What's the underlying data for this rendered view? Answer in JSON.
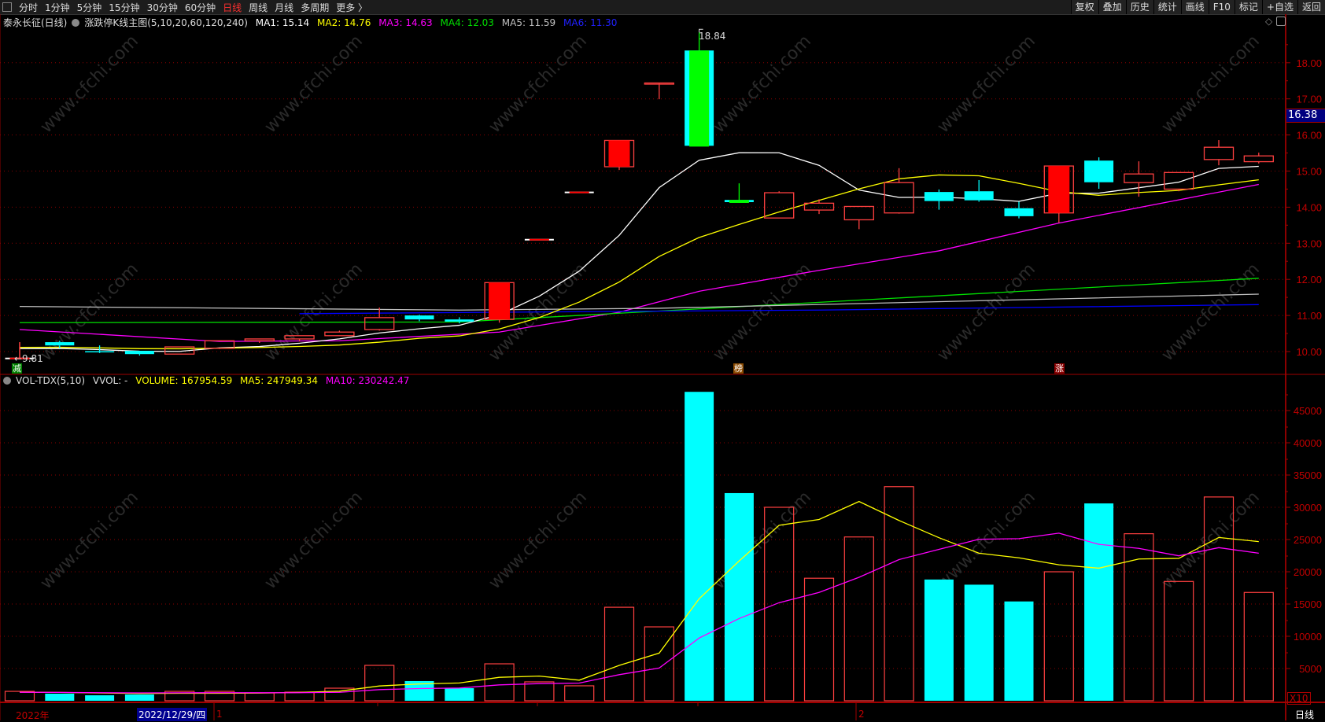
{
  "toolbar": {
    "periods": [
      "分时",
      "1分钟",
      "5分钟",
      "15分钟",
      "30分钟",
      "60分钟",
      "日线",
      "周线",
      "月线",
      "多周期",
      "更多 〉"
    ],
    "active_period": "日线",
    "actions": [
      "复权",
      "叠加",
      "历史",
      "统计",
      "画线",
      "F10",
      "标记",
      "+自选",
      "返回"
    ]
  },
  "info": {
    "stock": "泰永长征(日线)",
    "indicator": "涨跌停K线主图(5,10,20,60,120,240)",
    "ma": [
      {
        "label": "MA1: 15.14",
        "color": "#ffffff"
      },
      {
        "label": "MA2: 14.76",
        "color": "#ffff00"
      },
      {
        "label": "MA3: 14.63",
        "color": "#ff00ff"
      },
      {
        "label": "MA4: 12.03",
        "color": "#00e000"
      },
      {
        "label": "MA5: 11.59",
        "color": "#c0c0c0"
      },
      {
        "label": "MA6: 11.30",
        "color": "#0000ff"
      }
    ]
  },
  "vol_info": {
    "name": "VOL-TDX(5,10)",
    "vvol": "VVOL: -",
    "volume": "VOLUME: 167954.59",
    "ma5": "MA5: 247949.34",
    "ma10": "MA10: 230242.47"
  },
  "labels": {
    "high": "18.84",
    "low": "←9.81",
    "cursor_price": "16.38",
    "vol_unit": "X10",
    "period_tag": "日线",
    "watermark": "www.cfchi.com"
  },
  "markers": [
    {
      "bar": 0,
      "text": "减",
      "bg": "#008000"
    },
    {
      "bar": 18,
      "text": "榜",
      "bg": "#8b4a00"
    },
    {
      "bar": 26,
      "text": "涨",
      "bg": "#8b0000"
    }
  ],
  "date_axis": {
    "year": "2022年",
    "cursor_date": "2022/12/29/四",
    "month_labels": [
      {
        "bar": 5,
        "text": "1"
      },
      {
        "bar": 21,
        "text": "2"
      }
    ]
  },
  "chart_data": [
    {
      "type": "candlestick",
      "title": "泰永长征(日线)",
      "ylim": [
        9.6,
        18.9
      ],
      "yticks": [
        "10.00",
        "11.00",
        "12.00",
        "13.00",
        "14.00",
        "15.00",
        "16.00",
        "17.00",
        "18.00"
      ],
      "colors": {
        "up": "#ff4040",
        "down": "#00ffff",
        "limit_fill": "#ff0000",
        "green_core": "#00ff00"
      },
      "ohlc": [
        [
          9.81,
          10.26,
          10.26,
          9.81
        ],
        [
          10.26,
          10.3,
          10.09,
          10.17
        ],
        [
          10.01,
          10.17,
          9.96,
          9.99
        ],
        [
          10.02,
          10.02,
          9.89,
          9.93
        ],
        [
          9.93,
          10.13,
          9.93,
          10.13
        ],
        [
          10.09,
          10.3,
          10.07,
          10.3
        ],
        [
          10.3,
          10.35,
          10.24,
          10.35
        ],
        [
          10.35,
          10.44,
          10.28,
          10.44
        ],
        [
          10.44,
          10.58,
          10.44,
          10.54
        ],
        [
          10.61,
          11.22,
          10.58,
          10.94
        ],
        [
          11.0,
          11.02,
          10.84,
          10.89
        ],
        [
          10.89,
          10.95,
          10.78,
          10.83
        ],
        [
          10.89,
          11.91,
          10.8,
          11.91
        ],
        [
          13.1,
          13.1,
          13.1,
          13.1
        ],
        [
          14.41,
          14.41,
          14.41,
          14.41
        ],
        [
          15.12,
          15.85,
          15.03,
          15.85
        ],
        [
          17.44,
          17.44,
          16.99,
          17.44
        ],
        [
          18.34,
          18.84,
          15.7,
          15.7
        ],
        [
          14.2,
          14.66,
          14.12,
          14.14
        ],
        [
          13.7,
          14.44,
          13.7,
          14.4
        ],
        [
          13.92,
          14.22,
          13.81,
          14.11
        ],
        [
          13.65,
          14.02,
          13.39,
          14.02
        ],
        [
          13.84,
          15.08,
          13.82,
          14.68
        ],
        [
          14.42,
          14.49,
          13.93,
          14.17
        ],
        [
          14.44,
          14.75,
          14.15,
          14.19
        ],
        [
          13.97,
          14.15,
          13.69,
          13.75
        ],
        [
          13.84,
          15.14,
          13.57,
          15.14
        ],
        [
          15.29,
          15.38,
          14.51,
          14.69
        ],
        [
          14.68,
          15.27,
          14.29,
          14.92
        ],
        [
          14.5,
          14.96,
          14.44,
          14.96
        ],
        [
          15.32,
          15.86,
          15.16,
          15.66
        ],
        [
          15.26,
          15.51,
          15.21,
          15.42
        ]
      ],
      "filled_up_bars": [
        12,
        15,
        26
      ],
      "green_core_bars": [
        17,
        18
      ],
      "ma_computed": [
        {
          "name": "MA1",
          "period": 5,
          "color": "#ffffff"
        },
        {
          "name": "MA2",
          "period": 10,
          "color": "#ffff00"
        }
      ],
      "history_pad_close": 10.15,
      "ma_keypoints": [
        {
          "name": "MA3",
          "color": "#ff00ff",
          "points": [
            [
              0,
              10.61
            ],
            [
              5,
              10.28
            ],
            [
              8,
              10.3
            ],
            [
              12,
              10.54
            ],
            [
              15,
              11.09
            ],
            [
              17,
              11.67
            ],
            [
              20,
              12.25
            ],
            [
              23,
              12.79
            ],
            [
              26,
              13.56
            ],
            [
              31,
              14.63
            ]
          ]
        },
        {
          "name": "MA4",
          "color": "#00e000",
          "points": [
            [
              0,
              10.8
            ],
            [
              11,
              10.82
            ],
            [
              31,
              12.03
            ]
          ]
        },
        {
          "name": "MA5",
          "color": "#c0c0c0",
          "points": [
            [
              0,
              11.25
            ],
            [
              11,
              11.15
            ],
            [
              16,
              11.2
            ],
            [
              31,
              11.59
            ]
          ]
        },
        {
          "name": "MA6",
          "color": "#0000ff",
          "points": [
            [
              7,
              11.05
            ],
            [
              20,
              11.15
            ],
            [
              31,
              11.3
            ]
          ]
        }
      ]
    },
    {
      "type": "bar",
      "title": "VOL-TDX(5,10)",
      "unit": "X10",
      "ylim": [
        0,
        50000
      ],
      "yticks": [
        "5000",
        "10000",
        "15000",
        "20000",
        "25000",
        "30000",
        "35000",
        "40000",
        "45000"
      ],
      "values": [
        1460,
        1100,
        850,
        975,
        1460,
        1460,
        1220,
        1340,
        1950,
        5490,
        3050,
        1950,
        5730,
        2930,
        2320,
        14500,
        11460,
        47900,
        32200,
        30000,
        19000,
        25400,
        33200,
        18800,
        18000,
        15400,
        20000,
        30600,
        25900,
        18500,
        31600,
        16795
      ],
      "ma": [
        {
          "name": "MA5",
          "period": 5,
          "color": "#ffff00"
        },
        {
          "name": "MA10",
          "period": 10,
          "color": "#ff00ff"
        }
      ],
      "history_pad": 1300
    }
  ]
}
